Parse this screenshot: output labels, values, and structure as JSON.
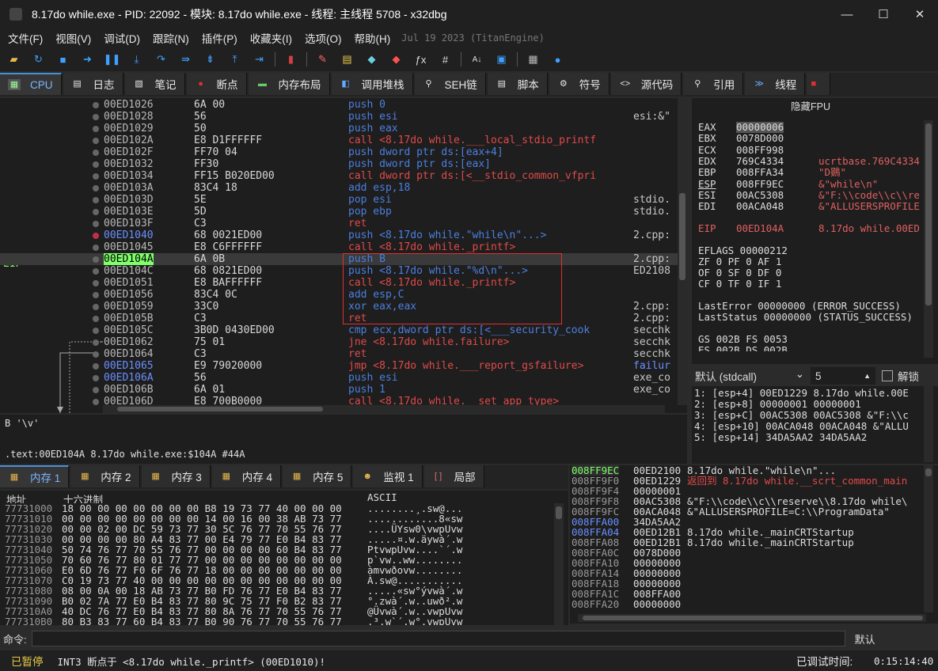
{
  "title": "8.17do while.exe - PID: 22092 - 模块: 8.17do while.exe - 线程: 主线程 5708 - x32dbg",
  "window_buttons": [
    "—",
    "☐",
    "✕"
  ],
  "menu": [
    "文件(F)",
    "视图(V)",
    "调试(D)",
    "跟踪(N)",
    "插件(P)",
    "收藏夹(I)",
    "选项(O)",
    "帮助(H)"
  ],
  "menu_date": "Jul 19 2023 (TitanEngine)",
  "tabs": [
    "CPU",
    "日志",
    "笔记",
    "断点",
    "内存布局",
    "调用堆栈",
    "SEH链",
    "脚本",
    "符号",
    "源代码",
    "引用",
    "线程"
  ],
  "eip_label": "EIP",
  "disasm": [
    {
      "addr": "00ED1026",
      "bytes": "6A 00",
      "instr": "push 0",
      "cmt": ""
    },
    {
      "addr": "00ED1028",
      "bytes": "56",
      "instr": "push esi",
      "cmt": "esi:&\""
    },
    {
      "addr": "00ED1029",
      "bytes": "50",
      "instr": "push eax",
      "cmt": ""
    },
    {
      "addr": "00ED102A",
      "bytes": "E8 D1FFFFFF",
      "instr": "call <8.17do while.___local_stdio_printf",
      "cmt": ""
    },
    {
      "addr": "00ED102F",
      "bytes": "FF70 04",
      "instr": "push dword ptr ds:[eax+4]",
      "cmt": ""
    },
    {
      "addr": "00ED1032",
      "bytes": "FF30",
      "instr": "push dword ptr ds:[eax]",
      "cmt": ""
    },
    {
      "addr": "00ED1034",
      "bytes": "FF15 B020ED00",
      "instr": "call dword ptr ds:[<__stdio_common_vfpri",
      "cmt": ""
    },
    {
      "addr": "00ED103A",
      "bytes": "83C4 18",
      "instr": "add esp,18",
      "cmt": ""
    },
    {
      "addr": "00ED103D",
      "bytes": "5E",
      "instr": "pop esi",
      "cmt": "stdio."
    },
    {
      "addr": "00ED103E",
      "bytes": "5D",
      "instr": "pop ebp",
      "cmt": "stdio."
    },
    {
      "addr": "00ED103F",
      "bytes": "C3",
      "instr": "ret",
      "cmt": ""
    },
    {
      "addr": "00ED1040",
      "bytes": "68 0021ED00",
      "instr": "push <8.17do while.\"while\\n\"...>",
      "cmt": "2.cpp:"
    },
    {
      "addr": "00ED1045",
      "bytes": "E8 C6FFFFFF",
      "instr": "call <8.17do while._printf>",
      "cmt": ""
    },
    {
      "addr": "00ED104A",
      "bytes": "6A 0B",
      "instr": "push B",
      "cmt": "2.cpp:"
    },
    {
      "addr": "00ED104C",
      "bytes": "68 0821ED00",
      "instr": "push <8.17do while.\"%d\\n\"...>",
      "cmt": "ED2108"
    },
    {
      "addr": "00ED1051",
      "bytes": "E8 BAFFFFFF",
      "instr": "call <8.17do while._printf>",
      "cmt": ""
    },
    {
      "addr": "00ED1056",
      "bytes": "83C4 0C",
      "instr": "add esp,C",
      "cmt": ""
    },
    {
      "addr": "00ED1059",
      "bytes": "33C0",
      "instr": "xor eax,eax",
      "cmt": "2.cpp:"
    },
    {
      "addr": "00ED105B",
      "bytes": "C3",
      "instr": "ret",
      "cmt": "2.cpp:"
    },
    {
      "addr": "00ED105C",
      "bytes": "3B0D 0430ED00",
      "instr": "cmp ecx,dword ptr ds:[<___security_cook",
      "cmt": "secchk"
    },
    {
      "addr": "00ED1062",
      "bytes": "75 01",
      "instr": "jne <8.17do while.failure>",
      "cmt": "secchk"
    },
    {
      "addr": "00ED1064",
      "bytes": "C3",
      "instr": "ret",
      "cmt": "secchk"
    },
    {
      "addr": "00ED1065",
      "bytes": "E9 79020000",
      "instr": "jmp <8.17do while.___report_gsfailure>",
      "cmt": "failur"
    },
    {
      "addr": "00ED106A",
      "bytes": "56",
      "instr": "push esi",
      "cmt": "exe_co"
    },
    {
      "addr": "00ED106B",
      "bytes": "6A 01",
      "instr": "push 1",
      "cmt": "exe_co"
    },
    {
      "addr": "00ED106D",
      "bytes": "E8 700B0000",
      "instr": "call <8.17do while.__set_app_type>",
      "cmt": ""
    }
  ],
  "info_line1": "B '\\v'",
  "info_line2": ".text:00ED104A 8.17do while.exe:$104A #44A",
  "regs_header": "隐藏FPU",
  "regs": [
    {
      "n": "EAX",
      "v": "00000006",
      "c": ""
    },
    {
      "n": "EBX",
      "v": "0078D000",
      "c": ""
    },
    {
      "n": "ECX",
      "v": "008FF998",
      "c": ""
    },
    {
      "n": "EDX",
      "v": "769C4334",
      "c": "ucrtbase.769C4334"
    },
    {
      "n": "EBP",
      "v": "008FFA34",
      "c": "\"D鷃\""
    },
    {
      "n": "ESP",
      "v": "008FF9EC",
      "c": "&\"while\\n\""
    },
    {
      "n": "ESI",
      "v": "00AC5308",
      "c": "&\"F:\\\\code\\\\c\\\\re"
    },
    {
      "n": "EDI",
      "v": "00ACA048",
      "c": "&\"ALLUSERSPROFILE"
    }
  ],
  "eip_reg": {
    "n": "EIP",
    "v": "00ED104A",
    "c": "8.17do while.00ED"
  },
  "eflags": "EFLAGS   00000212",
  "flags1": "ZF 0  PF 0  AF 1",
  "flags2": "OF 0  SF 0  DF 0",
  "flags3": "CF 0  TF 0  IF 1",
  "lasterror": "LastError  00000000 (ERROR_SUCCESS)",
  "laststatus": "LastStatus 00000000 (STATUS_SUCCESS)",
  "seg1": "GS 002B  FS 0053",
  "seg2": "ES 002B  DS 002B",
  "callconv": "默认 (stdcall)",
  "argcount": "5",
  "unlock_label": "解锁",
  "stack_args": [
    "1: [esp+4] 00ED1229 8.17do while.00E",
    "2: [esp+8] 00000001 00000001",
    "3: [esp+C] 00AC5308 00AC5308 &\"F:\\\\c",
    "4: [esp+10] 00ACA048 00ACA048 &\"ALLU",
    "5: [esp+14] 34DA5AA2 34DA5AA2"
  ],
  "dump_tabs": [
    "内存 1",
    "内存 2",
    "内存 3",
    "内存 4",
    "内存 5",
    "监视 1",
    "局部"
  ],
  "dump_headers": [
    "地址",
    "十六进制",
    "ASCII"
  ],
  "dump": [
    {
      "a": "77731000",
      "h": "18 00 00 00 00 00 00 00 B8 19 73 77 40 00 00 00",
      "s": "........¸.sw@..."
    },
    {
      "a": "77731010",
      "h": "00 00 00 00 00 00 00 00 14 00 16 00 38 AB 73 77",
      "s": "............8«sw"
    },
    {
      "a": "77731020",
      "h": "00 00 02 00 DC 59 73 77 30 5C 76 77 70 55 76 77",
      "s": "....ÜYsw0\\vwpUvw"
    },
    {
      "a": "77731030",
      "h": "00 00 00 00 80 A4 83 77 00 E4 79 77 E0 B4 83 77",
      "s": ".....¤.w.äywà´.w"
    },
    {
      "a": "77731040",
      "h": "50 74 76 77 70 55 76 77 00 00 00 00 60 B4 83 77",
      "s": "PtvwpUvw....`´.w"
    },
    {
      "a": "77731050",
      "h": "70 60 76 77 80 01 77 77 00 00 00 00 00 00 00 00",
      "s": "p`vw..ww........"
    },
    {
      "a": "77731060",
      "h": "E0 6D 76 77 F0 6F 76 77 18 00 00 00 00 00 00 00",
      "s": "àmvwðovw........"
    },
    {
      "a": "77731070",
      "h": "C0 19 73 77 40 00 00 00 00 00 00 00 00 00 00 00",
      "s": "À.sw@..........."
    },
    {
      "a": "77731080",
      "h": "08 00 0A 00 18 AB 73 77 B0 FD 76 77 E0 B4 83 77",
      "s": ".....«sw°ývwà´.w"
    },
    {
      "a": "77731090",
      "h": "B0 02 7A 77 E0 B4 83 77 80 9C 75 77 F0 B2 83 77",
      "s": "°.zwà´.w..uwð².w"
    },
    {
      "a": "777310A0",
      "h": "40 DC 76 77 E0 B4 83 77 80 8A 76 77 70 55 76 77",
      "s": "@Üvwà´.w..vwpUvw"
    },
    {
      "a": "777310B0",
      "h": "80 B3 83 77 60 B4 83 77 B0 90 76 77 70 55 76 77",
      "s": ".³.w`´.w°.vwpUvw"
    }
  ],
  "stack": [
    {
      "a": "008FF9EC",
      "v": "00ED2100",
      "c": "8.17do while.\"while\\n\"..."
    },
    {
      "a": "008FF9F0",
      "v": "00ED1229",
      "c": "返回到 8.17do while.__scrt_common_main"
    },
    {
      "a": "008FF9F4",
      "v": "00000001",
      "c": ""
    },
    {
      "a": "008FF9F8",
      "v": "00AC5308",
      "c": "&\"F:\\\\code\\\\c\\\\reserve\\\\8.17do while\\"
    },
    {
      "a": "008FF9FC",
      "v": "00ACA048",
      "c": "&\"ALLUSERSPROFILE=C:\\\\ProgramData\""
    },
    {
      "a": "008FFA00",
      "v": "34DA5AA2",
      "c": ""
    },
    {
      "a": "008FFA04",
      "v": "00ED12B1",
      "c": "8.17do while._mainCRTStartup"
    },
    {
      "a": "008FFA08",
      "v": "00ED12B1",
      "c": "8.17do while._mainCRTStartup"
    },
    {
      "a": "008FFA0C",
      "v": "0078D000",
      "c": ""
    },
    {
      "a": "008FFA10",
      "v": "00000000",
      "c": ""
    },
    {
      "a": "008FFA14",
      "v": "00000000",
      "c": ""
    },
    {
      "a": "008FFA18",
      "v": "00000000",
      "c": ""
    },
    {
      "a": "008FFA1C",
      "v": "008FFA00",
      "c": ""
    },
    {
      "a": "008FFA20",
      "v": "00000000",
      "c": ""
    }
  ],
  "cmd_label": "命令:",
  "cmd_default": "默认",
  "status": {
    "state": "已暂停",
    "msg": "INT3  断点于 <8.17do  while._printf> (00ED1010)!",
    "link": "00ED1010",
    "timelabel": "已调试时间:",
    "time": "0:15:14:40"
  },
  "colors": {
    "accent": "#4a90d9",
    "eip_green": "#7fff6a",
    "red": "#ff5050",
    "instr_blue": "#4c7fe0"
  }
}
